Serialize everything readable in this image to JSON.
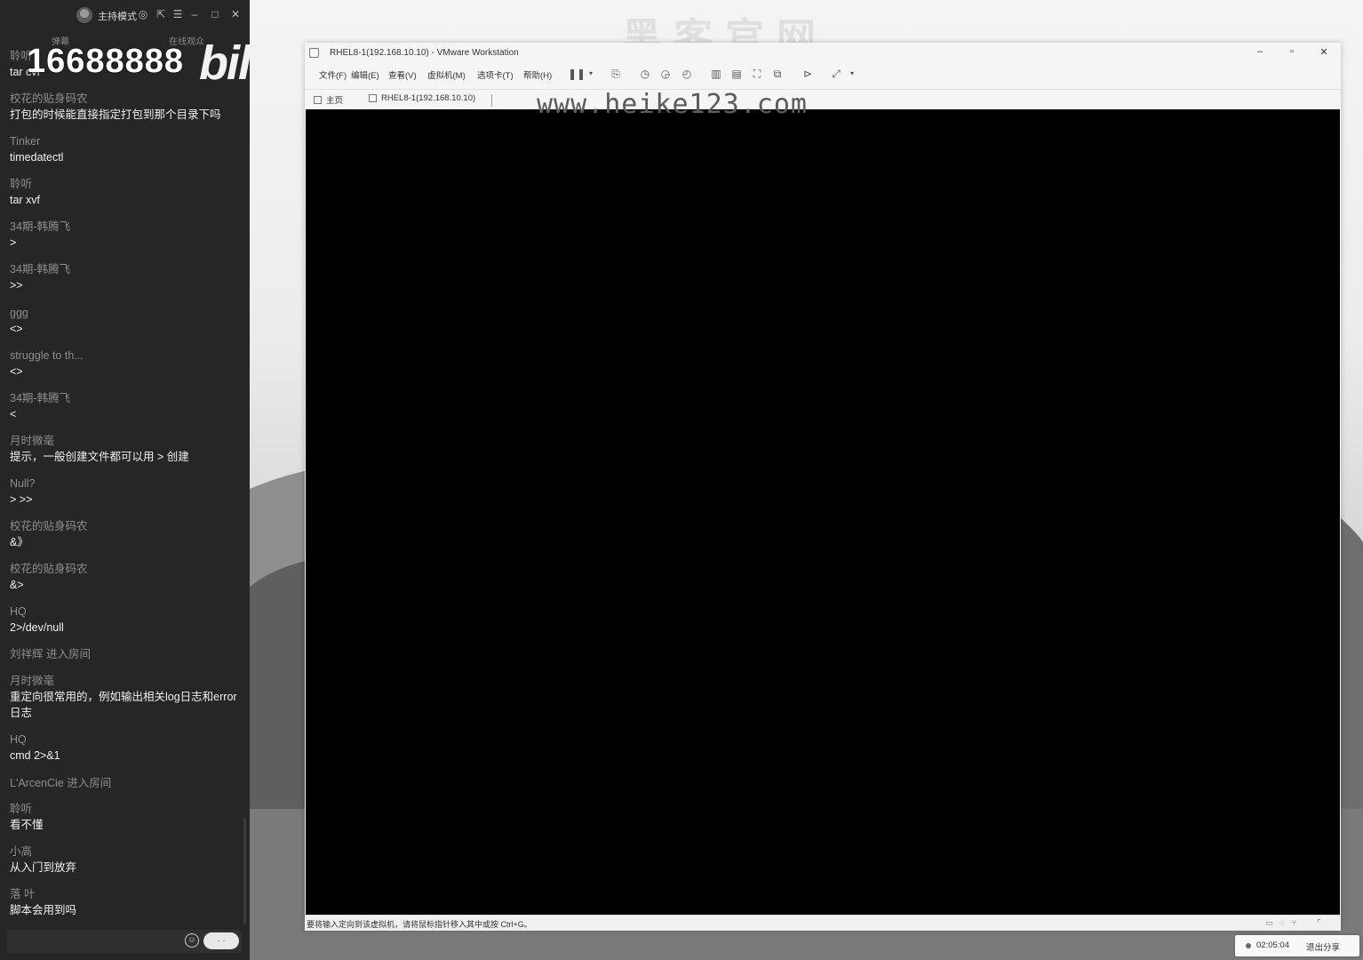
{
  "chat": {
    "titlebar": {
      "mode_label": "主持模式"
    },
    "tabs": [
      "弹幕",
      "在线观众"
    ],
    "overlay_number": "16688888",
    "overlay_logo": "bili",
    "messages": [
      {
        "user": "聆听",
        "text": "tar cvf"
      },
      {
        "user": "校花的贴身码农",
        "text": "打包的时候能直接指定打包到那个目录下吗"
      },
      {
        "user": "Tinker",
        "text": "timedatectl"
      },
      {
        "user": "聆听",
        "text": "tar xvf"
      },
      {
        "user": "34期-韩腾飞",
        "text": ">"
      },
      {
        "user": "34期-韩腾飞",
        "text": ">>"
      },
      {
        "user": "ggg",
        "text": "<>"
      },
      {
        "user": "struggle to th...",
        "text": "<>"
      },
      {
        "user": "34期-韩腾飞",
        "text": "<"
      },
      {
        "user": "月时微毫",
        "text": "提示，一般创建文件都可以用 > 创建"
      },
      {
        "user": "Null?",
        "text": ">  >>"
      },
      {
        "user": "校花的贴身码农",
        "text": "&》"
      },
      {
        "user": "校花的贴身码农",
        "text": "&>"
      },
      {
        "user": "HQ",
        "text": "2>/dev/null"
      },
      {
        "user": "刘祥辉 进入房间",
        "text": ""
      },
      {
        "user": "月时微毫",
        "text": "重定向很常用的，例如输出相关log日志和error日志"
      },
      {
        "user": "HQ",
        "text": "cmd 2>&1"
      },
      {
        "user": "L'ArcenCie 进入房间",
        "text": ""
      },
      {
        "user": "聆听",
        "text": "看不懂"
      },
      {
        "user": "小高",
        "text": "从入门到放弃"
      },
      {
        "user": "落 叶",
        "text": "脚本会用到吗"
      }
    ],
    "send_label": "· ·"
  },
  "watermark": {
    "top": "黑客官网",
    "site": "www.heike123.com"
  },
  "vmware": {
    "title": "RHEL8-1(192.168.10.10) - VMware Workstation",
    "menus": [
      "文件(F)",
      "编辑(E)",
      "查看(V)",
      "虚拟机(M)",
      "选项卡(T)",
      "帮助(H)"
    ],
    "tabs": {
      "home": "主页",
      "vm": "RHEL8-1(192.168.10.10)"
    },
    "status_hint": "要将输入定向到该虚拟机，请将鼠标指针移入其中或按 Ctrl+G。"
  },
  "share_bar": {
    "time": "02:05:04",
    "exit_label": "退出分享"
  }
}
